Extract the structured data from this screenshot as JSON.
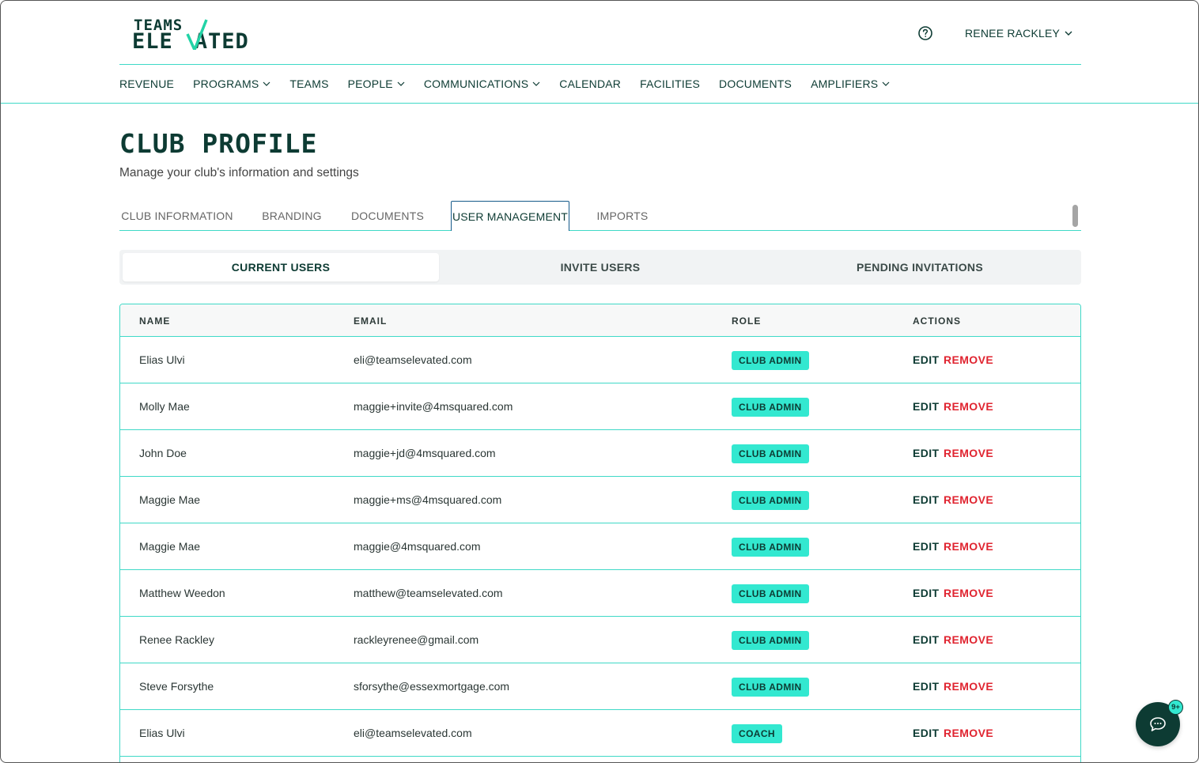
{
  "brand": {
    "logo_line1": "TEAMS",
    "logo_line2": "ELEVATED",
    "logo_part_left": "ELE",
    "logo_part_right": "ATED",
    "primary_color": "#0d3b33",
    "accent_color": "#33e8d0",
    "danger_color": "#e02430"
  },
  "header": {
    "help_icon": "question-circle-icon",
    "user_name": "RENEE RACKLEY"
  },
  "nav": {
    "items": [
      {
        "label": "REVENUE",
        "dropdown": false
      },
      {
        "label": "PROGRAMS",
        "dropdown": true
      },
      {
        "label": "TEAMS",
        "dropdown": false
      },
      {
        "label": "PEOPLE",
        "dropdown": true
      },
      {
        "label": "COMMUNICATIONS",
        "dropdown": true
      },
      {
        "label": "CALENDAR",
        "dropdown": false
      },
      {
        "label": "FACILITIES",
        "dropdown": false
      },
      {
        "label": "DOCUMENTS",
        "dropdown": false
      },
      {
        "label": "AMPLIFIERS",
        "dropdown": true
      }
    ]
  },
  "page": {
    "title": "CLUB PROFILE",
    "subtitle": "Manage your club's information and settings"
  },
  "tabs": {
    "items": [
      {
        "label": "CLUB INFORMATION",
        "active": false
      },
      {
        "label": "BRANDING",
        "active": false
      },
      {
        "label": "DOCUMENTS",
        "active": false
      },
      {
        "label": "USER MANAGEMENT",
        "active": true
      },
      {
        "label": "IMPORTS",
        "active": false
      }
    ]
  },
  "segments": {
    "items": [
      {
        "label": "CURRENT USERS",
        "active": true
      },
      {
        "label": "INVITE USERS",
        "active": false
      },
      {
        "label": "PENDING INVITATIONS",
        "active": false
      }
    ]
  },
  "table": {
    "headers": {
      "name": "NAME",
      "email": "EMAIL",
      "role": "ROLE",
      "actions": "ACTIONS"
    },
    "edit_label": "EDIT",
    "remove_label": "REMOVE",
    "rows": [
      {
        "name": "Elias Ulvi",
        "email": "eli@teamselevated.com",
        "role": "CLUB ADMIN"
      },
      {
        "name": "Molly Mae",
        "email": "maggie+invite@4msquared.com",
        "role": "CLUB ADMIN"
      },
      {
        "name": "John Doe",
        "email": "maggie+jd@4msquared.com",
        "role": "CLUB ADMIN"
      },
      {
        "name": "Maggie Mae",
        "email": "maggie+ms@4msquared.com",
        "role": "CLUB ADMIN"
      },
      {
        "name": "Maggie Mae",
        "email": "maggie@4msquared.com",
        "role": "CLUB ADMIN"
      },
      {
        "name": "Matthew Weedon",
        "email": "matthew@teamselevated.com",
        "role": "CLUB ADMIN"
      },
      {
        "name": "Renee Rackley",
        "email": "rackleyrenee@gmail.com",
        "role": "CLUB ADMIN"
      },
      {
        "name": "Steve Forsythe",
        "email": "sforsythe@essexmortgage.com",
        "role": "CLUB ADMIN"
      },
      {
        "name": "Elias Ulvi",
        "email": "eli@teamselevated.com",
        "role": "COACH"
      }
    ]
  },
  "chat": {
    "icon": "chat-bubble-icon",
    "badge": "9+"
  }
}
